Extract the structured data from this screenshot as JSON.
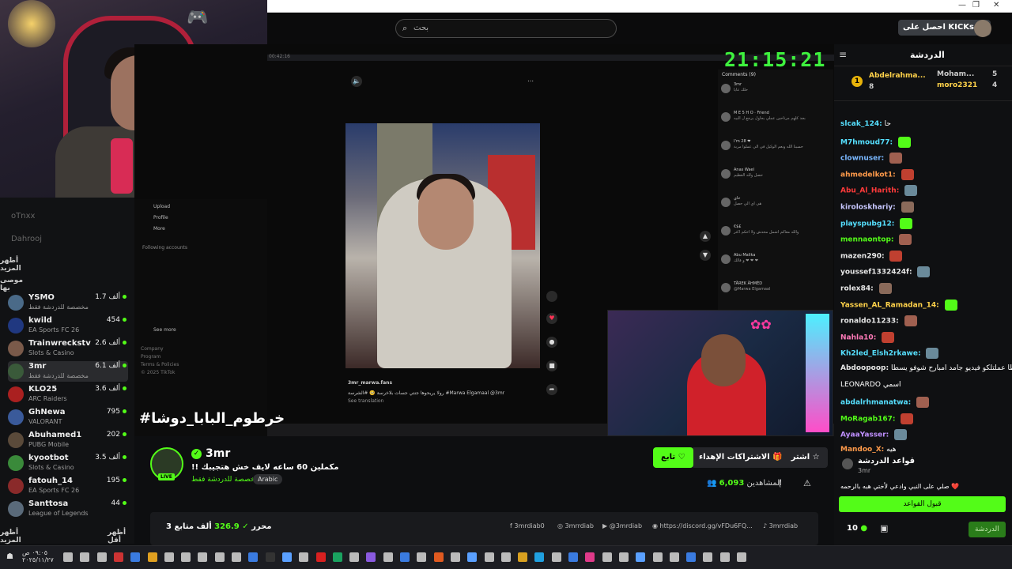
{
  "browser": {
    "minimize": "—",
    "restore": "❐",
    "close": "✕"
  },
  "topbar": {
    "search_placeholder": "بحث",
    "kick_button": "احصل على KICKs",
    "kick_badge": "K"
  },
  "sidebar": {
    "offline": [
      {
        "name": "oTnxx"
      },
      {
        "name": "Dahrooj"
      }
    ],
    "show_more": "أظهر المزيد",
    "recommended_heading": "موصى بها",
    "channels": [
      {
        "name": "YSMO",
        "category": "مخصصة للدردشة فقط",
        "viewers": "1.7 ألف",
        "color": "#4a6a88"
      },
      {
        "name": "kwild",
        "category": "EA Sports FC 26",
        "viewers": "454",
        "color": "#203880"
      },
      {
        "name": "Trainwreckstv",
        "category": "Slots & Casino",
        "viewers": "2.6 ألف",
        "color": "#7a5a4a"
      },
      {
        "name": "3mr",
        "category": "مخصصة للدردشة فقط",
        "viewers": "6.1 ألف",
        "color": "#3a5a3a"
      },
      {
        "name": "KLO25",
        "category": "ARC Raiders",
        "viewers": "3.6 ألف",
        "color": "#aa2020"
      },
      {
        "name": "GhNewa",
        "category": "VALORANT",
        "viewers": "795",
        "color": "#3a5a9a"
      },
      {
        "name": "Abuhamed1",
        "category": "PUBG Mobile",
        "viewers": "202",
        "color": "#5a4a3a"
      },
      {
        "name": "kyootbot",
        "category": "Slots & Casino",
        "viewers": "3.5 ألف",
        "color": "#3a8a3a"
      },
      {
        "name": "fatouh_14",
        "category": "EA Sports FC 26",
        "viewers": "195",
        "color": "#8a2a2a"
      },
      {
        "name": "Santtosa",
        "category": "League of Legends",
        "viewers": "44",
        "color": "#5a6a7a"
      }
    ],
    "show_less": "أظهر أقل",
    "show_more_bottom": "أظهر المزيد"
  },
  "video": {
    "clock": "21:15:21",
    "hashtag": "#خرطوم_البابا_دوشا",
    "tiktok_nav": [
      "Upload",
      "Profile",
      "More",
      "Following accounts",
      "See more",
      "Company",
      "Program",
      "Terms & Policies",
      "© 2025 TikTok"
    ],
    "tiktok_user": "3mr_marwa.fans",
    "tiktok_caption": "رولا يريحوها جنتي جسات بلاخرسة 🥺 #الشرسة #Marwa Elgamaal @3mr",
    "tiktok_translation": "See translation",
    "comments_header": "Comments (9)",
    "comments": [
      {
        "user": "3mr",
        "text": "حلك عايا"
      },
      {
        "user": "M E 5 H O · Friend",
        "text": "بجد كلهم مرتاحين عملي يحاول يرجع ل البيه"
      },
      {
        "user": "I'm 28 ❤",
        "text": "حسبنا الله ونعم الوكيل في الي عملوا مربة"
      },
      {
        "user": "Anas Wael",
        "text": "حصل ولله العظيم"
      },
      {
        "user": "حاي",
        "text": "هي اي الي حصل"
      },
      {
        "user": "€$£",
        "text": "والله معاكم اشمل محدش ولا احكم اكثر"
      },
      {
        "user": "Abu Malika",
        "text": "و قالك ❤ ❤ ❤"
      },
      {
        "user": "TÄREK ÄHMĖD",
        "text": "@Marwa Elgamaal"
      }
    ]
  },
  "stream": {
    "streamer": "3mr",
    "live_badge": "LIVE",
    "title": "!! مكملين 60 ساعه لايف خش هتجيبك",
    "category": "مخصصة للدردشة فقط",
    "language": "Arabic",
    "subscribe": "اشتراك",
    "gift_subs": "الاشتراكات الإهداء",
    "follow": "تابع",
    "viewers_label": "المشاهدين",
    "viewers": "6,093",
    "followers_count": "326.9",
    "followers_label": "ألف متابع",
    "followers_name": "3 محرر",
    "socials": [
      "3mrdiab0",
      "3mrrdiab",
      "@3mrdiab",
      "https://discord.gg/vFDu6FQ...",
      "3mrrdiab"
    ]
  },
  "chat": {
    "title": "الدردشة",
    "pinned": [
      {
        "rank": "1",
        "user": "Abdelrahma...",
        "count": "8"
      },
      {
        "user": "Moham...",
        "count": "5"
      },
      {
        "user": "moro2321",
        "count": "4"
      }
    ],
    "messages": [
      {
        "user": "slcak_124:",
        "color": "#56e0ff",
        "text": "حا"
      },
      {
        "user": "M7hmoud77:",
        "color": "#56e0ff",
        "text": ""
      },
      {
        "user": "clownuser:",
        "color": "#7ab8ff",
        "text": ""
      },
      {
        "user": "ahmedelkot1:",
        "color": "#ff9a4a",
        "text": ""
      },
      {
        "user": "Abu_Al_Harith:",
        "color": "#ff3a3a",
        "text": ""
      },
      {
        "user": "kiroloskhariy:",
        "color": "#c8c8ff",
        "text": ""
      },
      {
        "user": "playspubg12:",
        "color": "#56e0ff",
        "text": ""
      },
      {
        "user": "mennaontop:",
        "color": "#53fc18",
        "text": ""
      },
      {
        "user": "mazen290:",
        "color": "#e8e8e8",
        "text": ""
      },
      {
        "user": "youssef1332424f:",
        "color": "#e8e8e8",
        "text": ""
      },
      {
        "user": "rolex84:",
        "color": "#e8e8e8",
        "text": ""
      },
      {
        "user": "Yassen_AL_Ramadan_14:",
        "color": "#ffd24a",
        "text": ""
      },
      {
        "user": "ronaldo11233:",
        "color": "#e8e8e8",
        "text": ""
      },
      {
        "user": "Nahla10:",
        "color": "#ff7ab8",
        "text": ""
      },
      {
        "user": "Kh2led_Elsh2rkawe:",
        "color": "#56e0ff",
        "text": ""
      },
      {
        "user": "Abdoopoop:",
        "color": "#e8e8e8",
        "text": "يسطا عملتلكو فيديو جامد امبارح شوفو يسطا"
      },
      {
        "user": "",
        "color": "#e8e8e8",
        "text": "LEONARDO اسمي"
      },
      {
        "user": "abdalrhmanatwa:",
        "color": "#56e0ff",
        "text": ""
      },
      {
        "user": "MoRagab167:",
        "color": "#53fc18",
        "text": ""
      },
      {
        "user": "AyaaYasser:",
        "color": "#c090ff",
        "text": ""
      },
      {
        "user": "Mandoo_X:",
        "color": "#ff9a4a",
        "text": "هيه"
      }
    ],
    "rules_title": "قواعد الدردشة",
    "rules_streamer": "3mr",
    "rules_body": "صلي على النبي وادعي لأختي هبه بالرحمه ❤️",
    "accept_rules": "قبول القواعد",
    "points": "10",
    "chat_button": "الدردشة"
  },
  "os": {
    "time": "٠٩:٠٥ ص",
    "date": "٢٠٢٥/١١/٢٧"
  }
}
